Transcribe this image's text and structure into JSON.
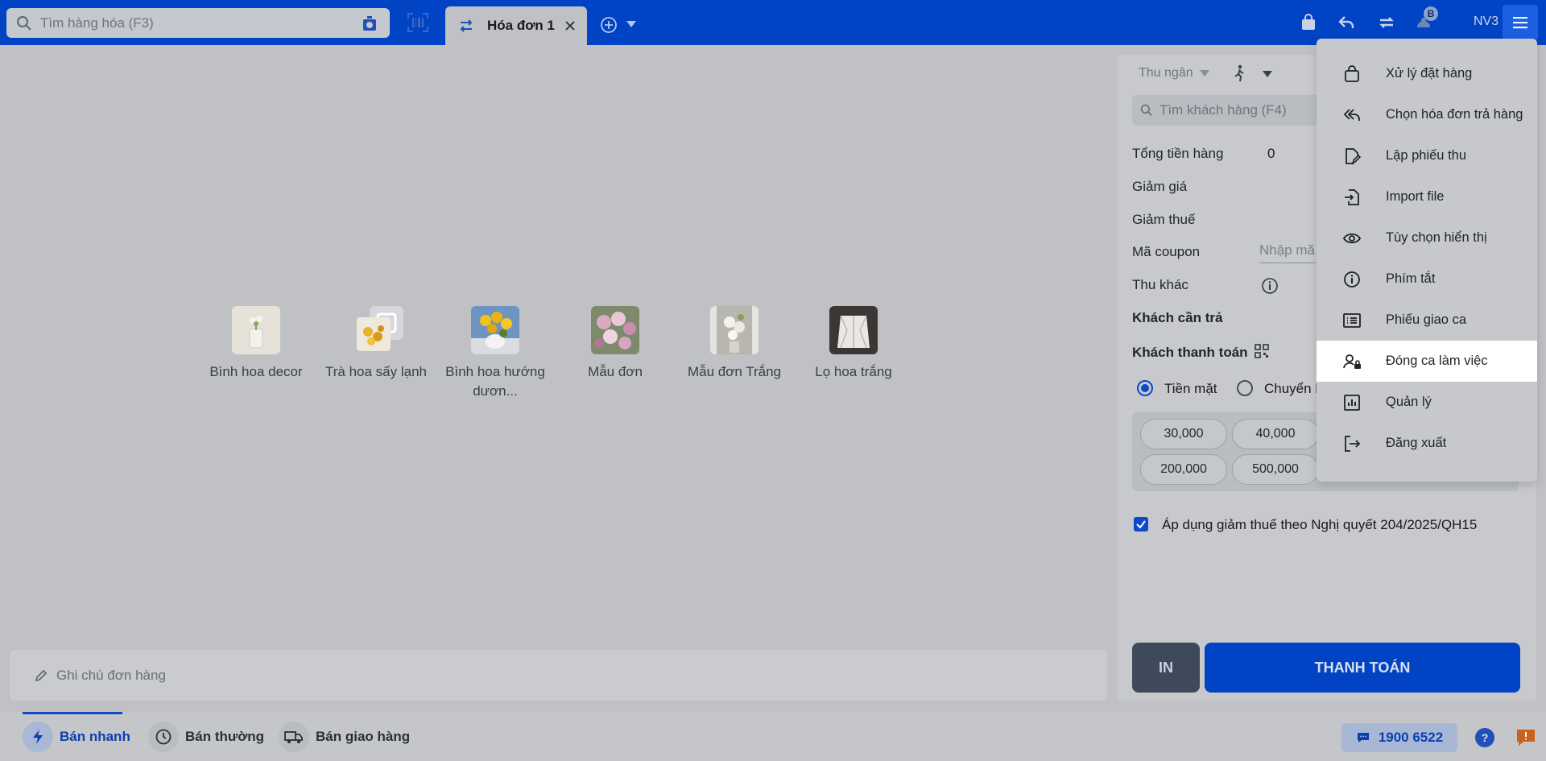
{
  "search": {
    "placeholder": "Tìm hàng hóa (F3)"
  },
  "tabs": [
    {
      "label": "Hóa đơn 1"
    }
  ],
  "header": {
    "user": "NV3",
    "badge": "B"
  },
  "products": [
    {
      "name": "Bình hoa decor"
    },
    {
      "name": "Trà hoa sấy lạnh"
    },
    {
      "name": "Bình hoa hướng dươn..."
    },
    {
      "name": "Mẫu đơn"
    },
    {
      "name": "Mẫu đơn Trắng"
    },
    {
      "name": "Lọ hoa trắng"
    }
  ],
  "note": {
    "placeholder": "Ghi chú đơn hàng"
  },
  "panel": {
    "cashier": "Thu ngân",
    "customer_search_placeholder": "Tìm khách hàng (F4)",
    "total_label": "Tổng tiền hàng",
    "total_value": "0",
    "discount_label": "Giảm giá",
    "tax_discount_label": "Giảm thuế",
    "coupon_label": "Mã coupon",
    "coupon_placeholder": "Nhập mã",
    "other_income_label": "Thu khác",
    "customer_pay_label": "Khách cần trả",
    "customer_paid_label": "Khách thanh toán",
    "payment_methods": [
      "Tiền mặt",
      "Chuyển k"
    ],
    "cash_suggestions": [
      "30,000",
      "40,000",
      "200,000",
      "500,000"
    ],
    "tax_checkbox_label": "Áp dụng giảm thuế theo Nghị quyết 204/2025/QH15",
    "print_button": "IN",
    "pay_button": "THANH TOÁN"
  },
  "menu": {
    "items": [
      {
        "label": "Xử lý đặt hàng",
        "icon": "bag-icon"
      },
      {
        "label": "Chọn hóa đơn trả hàng",
        "icon": "return-icon"
      },
      {
        "label": "Lập phiếu thu",
        "icon": "receipt-edit-icon"
      },
      {
        "label": "Import file",
        "icon": "import-icon"
      },
      {
        "label": "Tùy chọn hiển thị",
        "icon": "eye-icon"
      },
      {
        "label": "Phím tắt",
        "icon": "info-icon"
      },
      {
        "label": "Phiếu giao ca",
        "icon": "list-icon"
      },
      {
        "label": "Đóng ca làm việc",
        "icon": "user-lock-icon"
      },
      {
        "label": "Quản lý",
        "icon": "chart-icon"
      },
      {
        "label": "Đăng xuất",
        "icon": "logout-icon"
      }
    ],
    "active_index": 7
  },
  "bottom": {
    "items": [
      {
        "label": "Bán nhanh",
        "icon": "bolt-icon"
      },
      {
        "label": "Bán thường",
        "icon": "clock-icon"
      },
      {
        "label": "Bán giao hàng",
        "icon": "truck-icon"
      }
    ],
    "hotline": "1900 6522",
    "help": "?"
  },
  "colors": {
    "brand": "#0043c4",
    "overlay": "#bfc1c4",
    "active_menu": "#ffffff"
  }
}
